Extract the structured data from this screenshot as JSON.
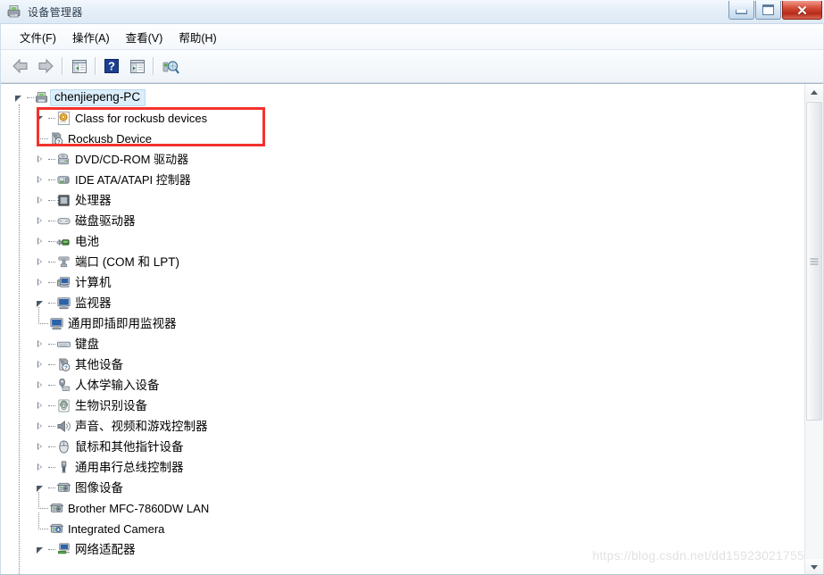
{
  "window": {
    "title": "设备管理器",
    "title_icon": "device-manager-icon",
    "buttons": {
      "minimize": "minimize-button",
      "maximize": "maximize-button",
      "close_glyph": "✕"
    }
  },
  "menu": {
    "items": [
      {
        "label": "文件(F)",
        "name": "menu-file"
      },
      {
        "label": "操作(A)",
        "name": "menu-action"
      },
      {
        "label": "查看(V)",
        "name": "menu-view"
      },
      {
        "label": "帮助(H)",
        "name": "menu-help"
      }
    ]
  },
  "toolbar": {
    "buttons": [
      {
        "name": "back-button",
        "icon": "left-arrow-icon"
      },
      {
        "name": "forward-button",
        "icon": "right-arrow-icon"
      },
      {
        "name": "show-hide-console-tree-button",
        "icon": "console-tree-icon"
      },
      {
        "name": "help-button",
        "icon": "question-mark-icon"
      },
      {
        "name": "show-hide-action-pane-button",
        "icon": "action-pane-icon"
      },
      {
        "name": "scan-for-hardware-changes-button",
        "icon": "scan-hardware-icon"
      }
    ]
  },
  "tree": {
    "root": {
      "label": "chenjiepeng-PC",
      "icon": "computer-icon",
      "state": "expanded",
      "selected": true
    },
    "nodes": [
      {
        "label": "Class for rockusb devices",
        "icon": "generic-class-icon",
        "state": "expanded",
        "level": 1,
        "highlighted": true
      },
      {
        "label": "Rockusb Device",
        "icon": "unknown-device-icon",
        "state": "leaf",
        "level": 2,
        "highlighted": true
      },
      {
        "label": "DVD/CD-ROM 驱动器",
        "icon": "dvd-drive-icon",
        "state": "collapsed",
        "level": 1
      },
      {
        "label": "IDE ATA/ATAPI 控制器",
        "icon": "ide-controller-icon",
        "state": "collapsed",
        "level": 1
      },
      {
        "label": "处理器",
        "icon": "processor-icon",
        "state": "collapsed",
        "level": 1
      },
      {
        "label": "磁盘驱动器",
        "icon": "disk-drive-icon",
        "state": "collapsed",
        "level": 1
      },
      {
        "label": "电池",
        "icon": "battery-icon",
        "state": "collapsed",
        "level": 1
      },
      {
        "label": "端口 (COM 和 LPT)",
        "icon": "ports-icon",
        "state": "collapsed",
        "level": 1
      },
      {
        "label": "计算机",
        "icon": "computer-node-icon",
        "state": "collapsed",
        "level": 1
      },
      {
        "label": "监视器",
        "icon": "monitor-icon",
        "state": "expanded",
        "level": 1
      },
      {
        "label": "通用即插即用监视器",
        "icon": "monitor-icon",
        "state": "leaf",
        "level": 2
      },
      {
        "label": "键盘",
        "icon": "keyboard-icon",
        "state": "collapsed",
        "level": 1
      },
      {
        "label": "其他设备",
        "icon": "unknown-device-icon",
        "state": "collapsed",
        "level": 1
      },
      {
        "label": "人体学输入设备",
        "icon": "hid-icon",
        "state": "collapsed",
        "level": 1
      },
      {
        "label": "生物识别设备",
        "icon": "biometric-icon",
        "state": "collapsed",
        "level": 1
      },
      {
        "label": "声音、视频和游戏控制器",
        "icon": "speaker-icon",
        "state": "collapsed",
        "level": 1
      },
      {
        "label": "鼠标和其他指针设备",
        "icon": "mouse-icon",
        "state": "collapsed",
        "level": 1
      },
      {
        "label": "通用串行总线控制器",
        "icon": "usb-icon",
        "state": "collapsed",
        "level": 1
      },
      {
        "label": "图像设备",
        "icon": "imaging-device-icon",
        "state": "expanded",
        "level": 1
      },
      {
        "label": "Brother MFC-7860DW LAN",
        "icon": "imaging-device-icon",
        "state": "leaf",
        "level": 2
      },
      {
        "label": "Integrated Camera",
        "icon": "camera-icon",
        "state": "leaf",
        "level": 2
      },
      {
        "label": "网络适配器",
        "icon": "network-adapter-icon",
        "state": "expanded",
        "level": 1
      }
    ]
  },
  "scrollbar": {
    "up_arrow": "scroll-up-arrow",
    "down_arrow": "scroll-down-arrow",
    "thumb": "scroll-thumb"
  },
  "watermark": {
    "text": "https://blog.csdn.net/dd15923021755"
  },
  "colors": {
    "highlight_red": "#f4322e",
    "selection_blue": "#dceefb",
    "titlebar_text": "#23384e",
    "close_button_red": "#b62a18"
  }
}
